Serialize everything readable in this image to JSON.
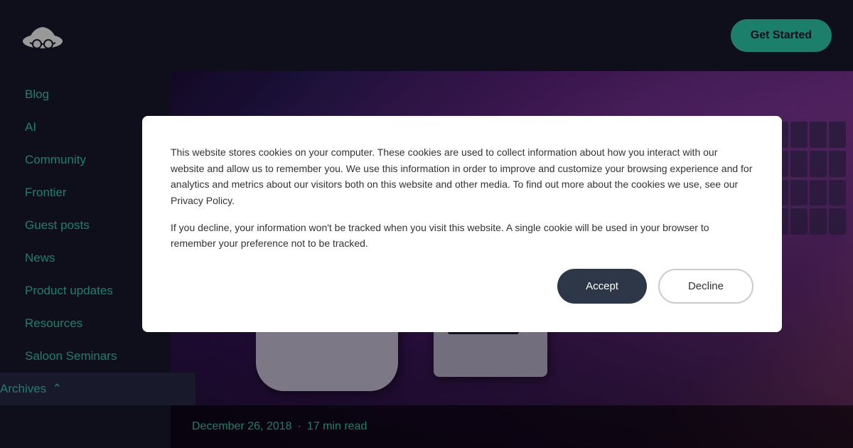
{
  "header": {
    "get_started_label": "Get Started"
  },
  "sidebar": {
    "items": [
      {
        "label": "Blog",
        "id": "blog"
      },
      {
        "label": "AI",
        "id": "ai"
      },
      {
        "label": "Community",
        "id": "community"
      },
      {
        "label": "Frontier",
        "id": "frontier"
      },
      {
        "label": "Guest posts",
        "id": "guest-posts"
      },
      {
        "label": "News",
        "id": "news"
      },
      {
        "label": "Product updates",
        "id": "product-updates"
      },
      {
        "label": "Resources",
        "id": "resources"
      },
      {
        "label": "Saloon Seminars",
        "id": "saloon-seminars"
      },
      {
        "label": "Archives",
        "id": "archives"
      }
    ]
  },
  "hero": {
    "date": "December 26, 2018",
    "read_time": "17 min read",
    "separator": "·"
  },
  "cookie": {
    "text1": "This website stores cookies on your computer. These cookies are used to collect information about how you interact with our website and allow us to remember you. We use this information in order to improve and customize your browsing experience and for analytics and metrics about our visitors both on this website and other media. To find out more about the cookies we use, see our Privacy Policy.",
    "text2": "If you decline, your information won't be tracked when you visit this website. A single cookie will be used in your browser to remember your preference not to be tracked.",
    "accept_label": "Accept",
    "decline_label": "Decline"
  }
}
